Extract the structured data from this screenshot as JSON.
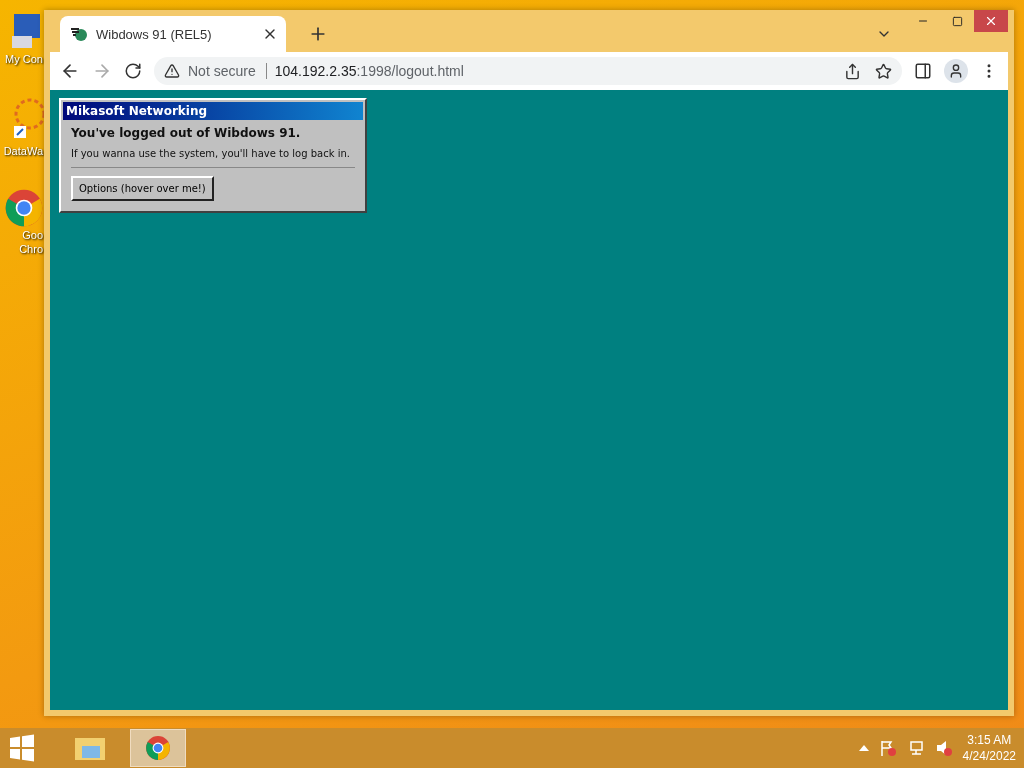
{
  "desktop_icons": [
    {
      "kind": "computer",
      "lines": [
        "My Con"
      ]
    },
    {
      "kind": "star",
      "lines": [
        "DataWa"
      ]
    },
    {
      "kind": "chrome",
      "lines": [
        "Goo",
        "Chro"
      ]
    }
  ],
  "browser": {
    "tab": {
      "title": "Wibdows 91 (REL5)"
    },
    "address": {
      "security": "Not secure",
      "host": "104.192.2.35",
      "path": ":1998/logout.html"
    }
  },
  "dialog": {
    "title": "Mikasoft Networking",
    "heading": "You've logged out of Wibdows 91.",
    "message": "If you wanna use the system, you'll have to log back in.",
    "button": "Options (hover over me!)"
  },
  "taskbar": {
    "items": [
      {
        "kind": "folder",
        "selected": false
      },
      {
        "kind": "chrome",
        "selected": true
      }
    ],
    "time": "3:15 AM",
    "date": "4/24/2022"
  }
}
